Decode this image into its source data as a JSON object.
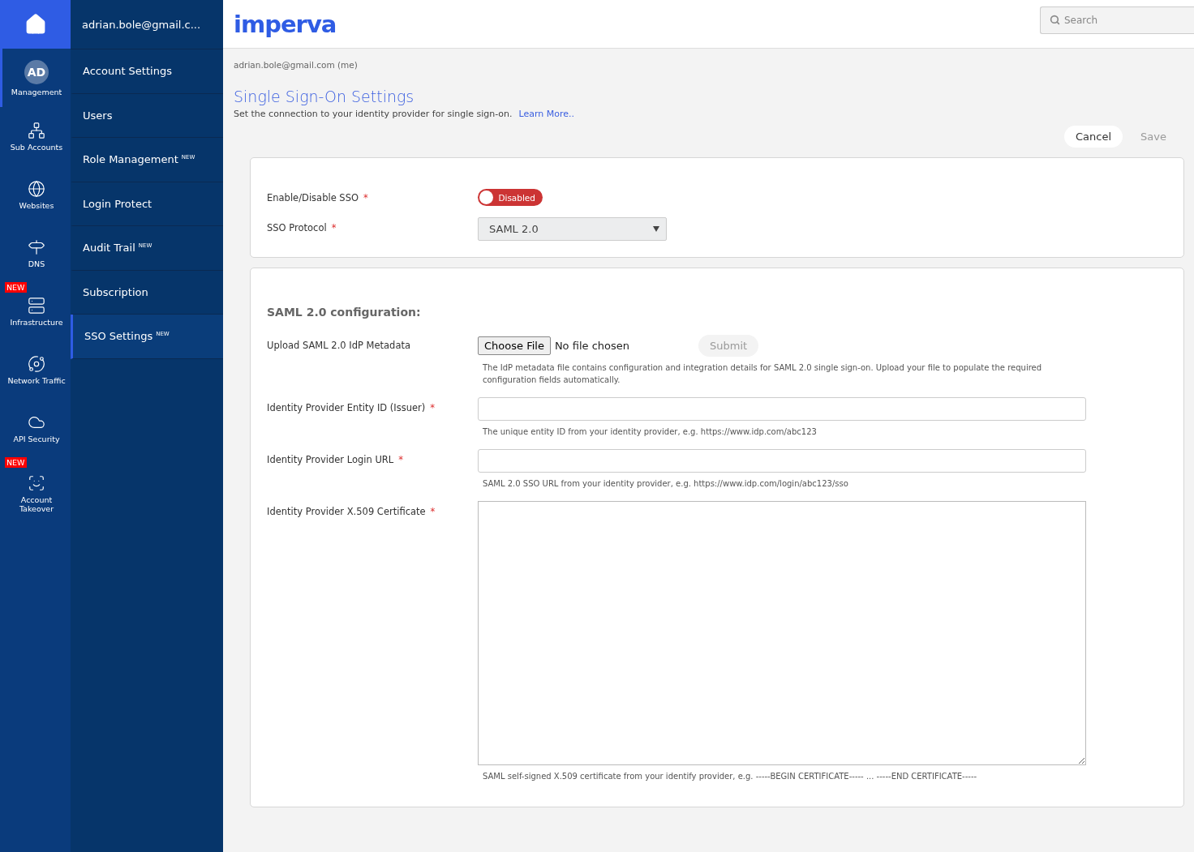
{
  "rail": {
    "items": [
      {
        "kind": "avatar",
        "initials": "AD",
        "label": "Management",
        "selected": true
      },
      {
        "kind": "icon",
        "label": "Sub Accounts",
        "selected": false
      },
      {
        "kind": "icon",
        "label": "Websites",
        "selected": false
      },
      {
        "kind": "icon",
        "label": "DNS",
        "selected": false
      },
      {
        "kind": "icon",
        "label": "Infrastructure",
        "selected": false,
        "badge": "NEW"
      },
      {
        "kind": "icon",
        "label": "Network Traffic",
        "selected": false
      },
      {
        "kind": "icon",
        "label": "API Security",
        "selected": false
      },
      {
        "kind": "icon",
        "label": "Account Takeover",
        "selected": false,
        "badge": "NEW"
      }
    ]
  },
  "submenu": {
    "account": "adrian.bole@gmail.c...",
    "items": [
      {
        "label": "Account Settings",
        "selected": false
      },
      {
        "label": "Users",
        "selected": false
      },
      {
        "label": "Role Management",
        "badge": "NEW",
        "selected": false
      },
      {
        "label": "Login Protect",
        "selected": false
      },
      {
        "label": "Audit Trail",
        "badge": "NEW",
        "selected": false
      },
      {
        "label": "Subscription",
        "selected": false
      },
      {
        "label": "SSO Settings",
        "badge": "NEW",
        "selected": true
      }
    ]
  },
  "header": {
    "logo": "imperva",
    "search": {
      "placeholder": "Search"
    }
  },
  "breadcrumb": "adrian.bole@gmail.com (me)",
  "page": {
    "title": "Single Sign-On Settings",
    "description": "Set the connection to your identity provider for single sign-on.",
    "link": "Learn More..",
    "buttons": [
      {
        "label": "Cancel",
        "disabled": false
      },
      {
        "label": "Save",
        "disabled": true
      }
    ]
  },
  "general": {
    "rows": [
      {
        "kind": "toggle",
        "label": "Enable/Disable SSO",
        "required": "*",
        "on": false,
        "value": "Disabled"
      },
      {
        "kind": "select",
        "label": "SSO Protocol",
        "required": "*",
        "value": "SAML 2.0"
      }
    ]
  },
  "saml": {
    "title": "SAML 2.0 configuration:",
    "rows": [
      {
        "kind": "file",
        "label": "Upload SAML 2.0 IdP Metadata",
        "button": "Choose File",
        "status": "No file chosen",
        "submit": {
          "label": "Submit",
          "disabled": true
        },
        "help": "The IdP metadata file contains configuration and integration details for SAML 2.0 single sign-on. Upload your file to populate the required configuration fields automatically."
      },
      {
        "kind": "input",
        "label": "Identity Provider Entity ID (Issuer)",
        "required": "*",
        "help": "The unique entity ID from your identity provider, e.g. https://www.idp.com/abc123"
      },
      {
        "kind": "input",
        "label": "Identity Provider Login URL",
        "required": "*",
        "help": "SAML 2.0 SSO URL from your identity provider, e.g. https://www.idp.com/login/abc123/sso"
      },
      {
        "kind": "textarea",
        "label": "Identity Provider X.509 Certificate",
        "required": "*",
        "help": "SAML self-signed X.509 certificate from your identify provider, e.g. -----BEGIN CERTIFICATE----- ... -----END CERTIFICATE-----"
      }
    ]
  }
}
